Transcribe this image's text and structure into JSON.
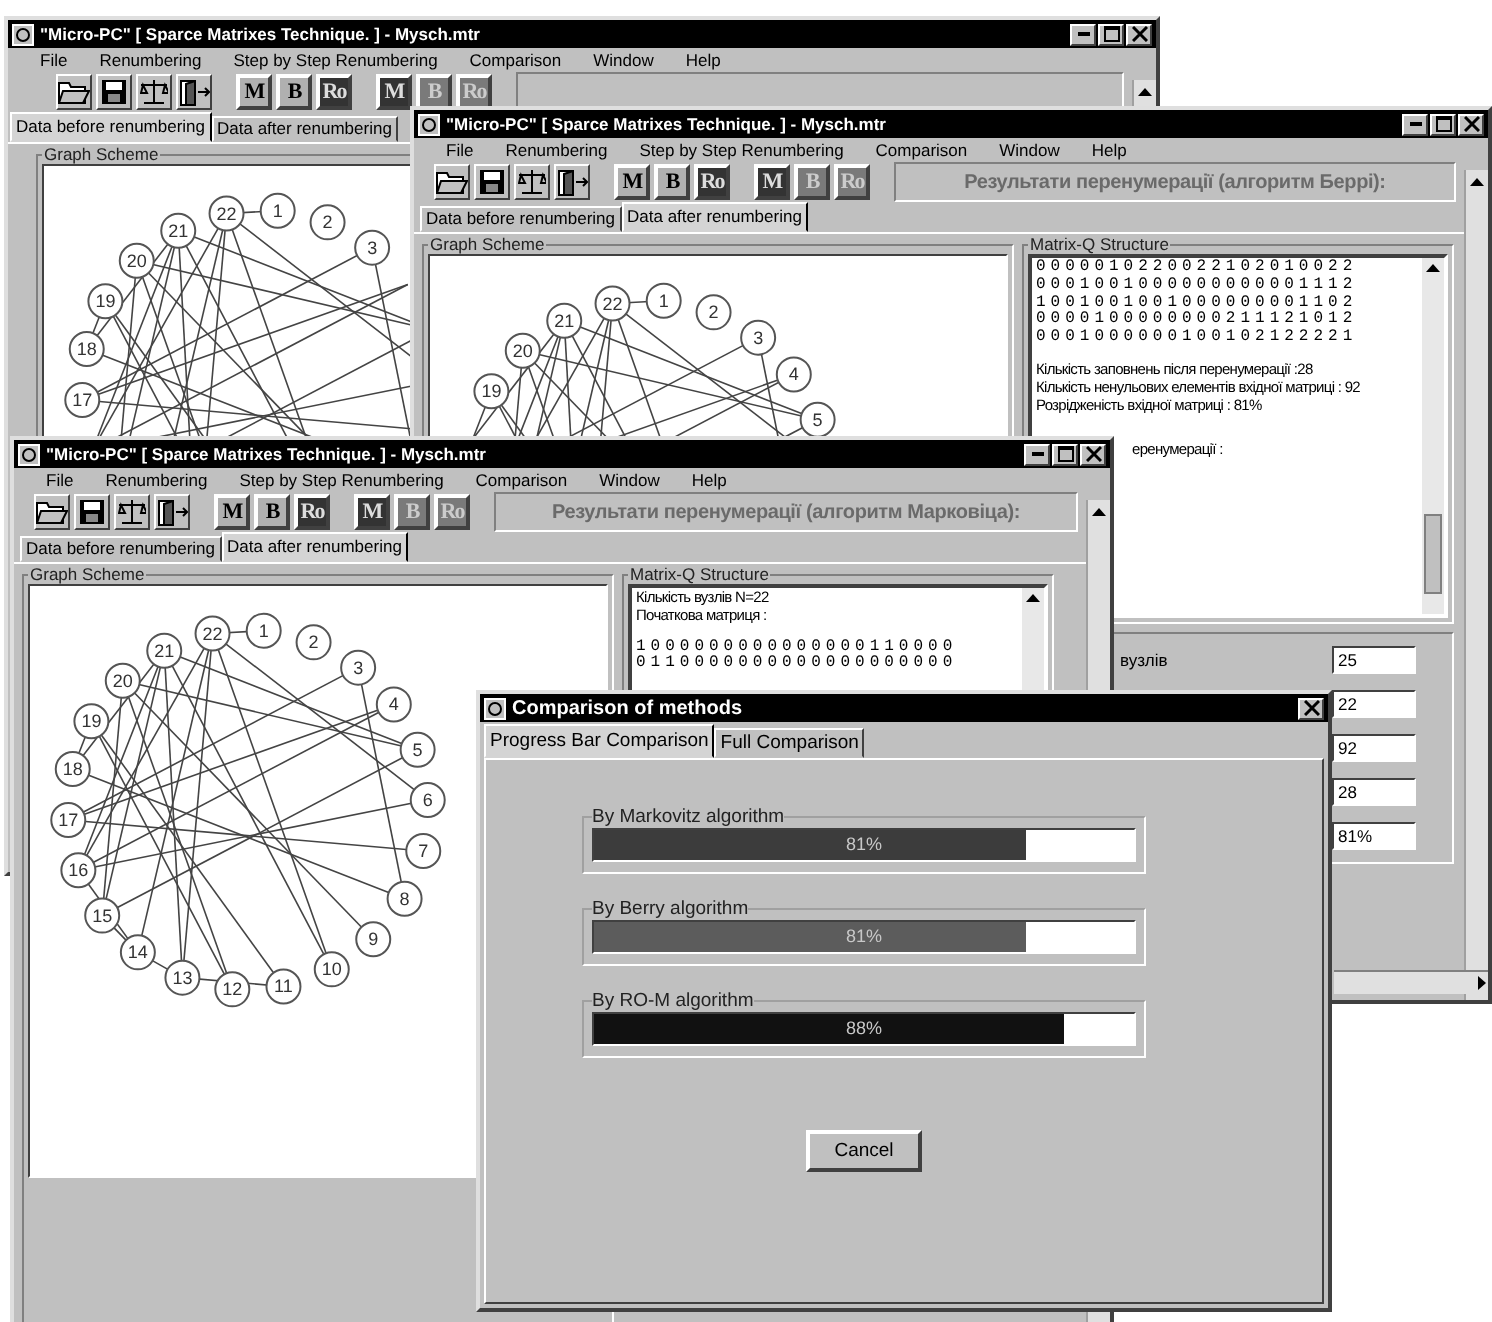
{
  "windows": [
    {
      "title": "\"Micro-PC\" [ Sparce Matrixes Technique. ] - Mysch.mtr",
      "menu": [
        "File",
        "Renumbering",
        "Step by Step Renumbering",
        "Comparison",
        "Window",
        "Help"
      ],
      "toolbar": [
        {
          "label": "M",
          "kind": "light"
        },
        {
          "label": "B",
          "kind": "light"
        },
        {
          "label": "Ro",
          "kind": "dark"
        },
        {
          "label": "M",
          "kind": "dark"
        },
        {
          "label": "B",
          "kind": "dim"
        },
        {
          "label": "Ro",
          "kind": "dim"
        }
      ],
      "tabs": [
        {
          "label": "Data before renumbering",
          "selected": true
        },
        {
          "label": "Data after renumbering",
          "selected": false
        }
      ],
      "graph": {
        "title": "Graph Scheme",
        "nodes": [
          "22",
          "1",
          "2",
          "3",
          "21",
          "20",
          "19",
          "18",
          "17"
        ]
      }
    },
    {
      "title": "\"Micro-PC\" [ Sparce Matrixes Technique. ] - Mysch.mtr",
      "menu": [
        "File",
        "Renumbering",
        "Step by Step Renumbering",
        "Comparison",
        "Window",
        "Help"
      ],
      "toolbar": [
        {
          "label": "M",
          "kind": "light"
        },
        {
          "label": "B",
          "kind": "light"
        },
        {
          "label": "Ro",
          "kind": "dark"
        },
        {
          "label": "M",
          "kind": "dark"
        },
        {
          "label": "B",
          "kind": "dim"
        },
        {
          "label": "Ro",
          "kind": "dim"
        }
      ],
      "heading": "Результати перенумерації (алгоритм Беррі):",
      "tabs": [
        {
          "label": "Data before renumbering",
          "selected": false
        },
        {
          "label": "Data after renumbering",
          "selected": true
        }
      ],
      "graph": {
        "title": "Graph Scheme",
        "nodes": [
          "22",
          "1",
          "2",
          "3",
          "4",
          "5",
          "21",
          "20",
          "19"
        ]
      },
      "matrix": {
        "title": "Matrix-Q Structure",
        "rows": [
          "0000010220022102010022",
          "0001001000000000001112",
          "1001001001000000001102",
          "0000100000000211121012",
          "0001000000100102122221"
        ],
        "info_lines": [
          "Кількість заповнень після перенумерації :28",
          "Кількість ненульових елементів вхідної матриці : 92",
          "Розрідженість вхідної матриці : 81%"
        ],
        "partial_line": "еренумерації :"
      },
      "fields": [
        {
          "label": "вузлів",
          "value": "25"
        },
        {
          "value": "22"
        },
        {
          "value": "92"
        },
        {
          "value": "28"
        },
        {
          "value": "81%"
        }
      ]
    },
    {
      "title": "\"Micro-PC\" [ Sparce Matrixes Technique. ] - Mysch.mtr",
      "menu": [
        "File",
        "Renumbering",
        "Step by Step Renumbering",
        "Comparison",
        "Window",
        "Help"
      ],
      "toolbar": [
        {
          "label": "M",
          "kind": "light"
        },
        {
          "label": "B",
          "kind": "light"
        },
        {
          "label": "Ro",
          "kind": "dark"
        },
        {
          "label": "M",
          "kind": "dark"
        },
        {
          "label": "B",
          "kind": "dim"
        },
        {
          "label": "Ro",
          "kind": "dim"
        }
      ],
      "heading": "Результати перенумерації (алгоритм Марковіца):",
      "tabs": [
        {
          "label": "Data before renumbering",
          "selected": false
        },
        {
          "label": "Data after renumbering",
          "selected": true
        }
      ],
      "graph": {
        "title": "Graph Scheme",
        "nodes": [
          "1",
          "2",
          "3",
          "4",
          "5",
          "6",
          "7",
          "8",
          "9",
          "10",
          "12",
          "11",
          "13",
          "14",
          "15",
          "16",
          "17",
          "18",
          "19",
          "20",
          "21",
          "22"
        ]
      },
      "matrix": {
        "title": "Matrix-Q Structure",
        "info_lines": [
          "Кількість вузлів  N=22",
          "Початкова матриця :"
        ],
        "rows": [
          "1000000000000000110000",
          "0110000000000000000000"
        ]
      }
    }
  ],
  "dialog": {
    "title": "Comparison of methods",
    "tabs": [
      {
        "label": "Progress Bar Comparison",
        "selected": true
      },
      {
        "label": "Full Comparison",
        "selected": false
      }
    ],
    "bars": [
      {
        "title": "By Markovitz algorithm",
        "reading": "81%",
        "level": 0.8,
        "color": "#3c3c3c"
      },
      {
        "title": "By Berry algorithm",
        "reading": "81%",
        "level": 0.8,
        "color": "#5c5c5c"
      },
      {
        "title": "By RO-M algorithm",
        "reading": "88%",
        "level": 0.87,
        "color": "#111111"
      }
    ],
    "button": "Cancel"
  }
}
